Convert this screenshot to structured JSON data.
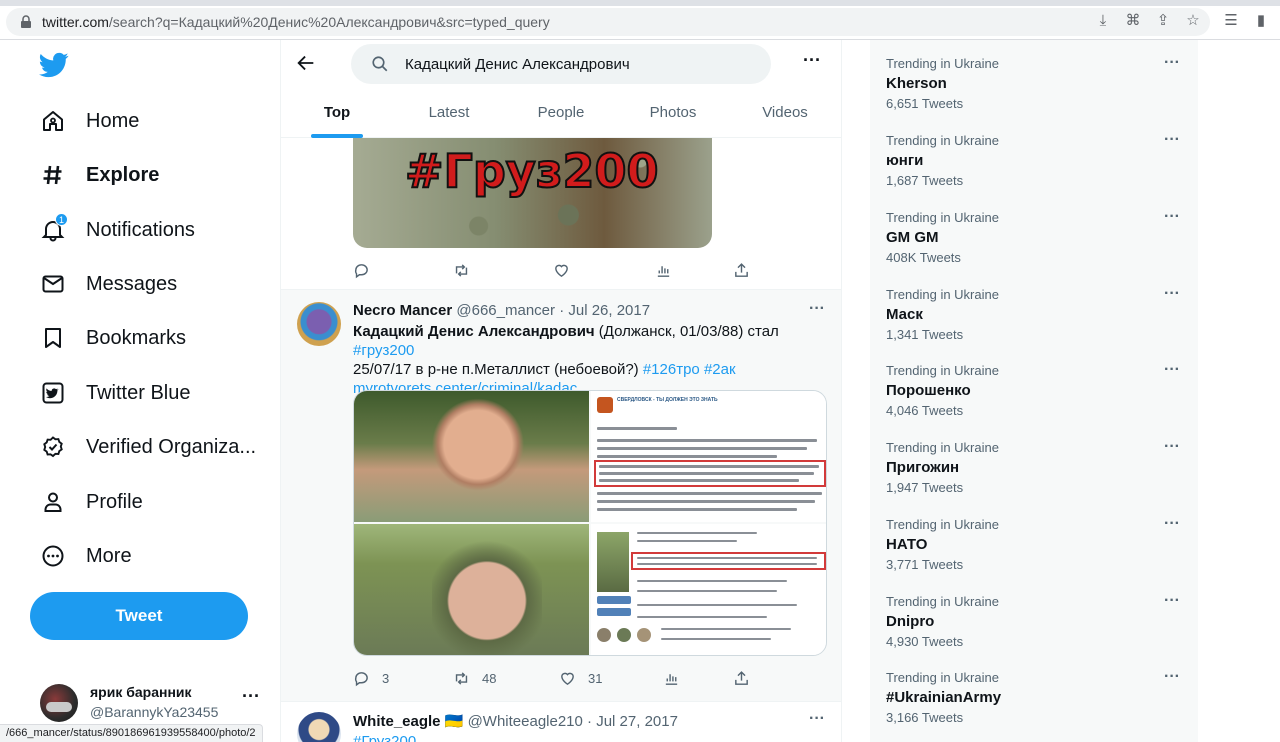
{
  "browser": {
    "url_host": "twitter.com",
    "url_rest": "/search?q=Кадацкий%20Денис%20Александрович&src=typed_query",
    "status_url": "/666_mancer/status/890186961939558400/photo/2"
  },
  "nav": {
    "items": [
      {
        "label": "Home",
        "icon": "home-icon"
      },
      {
        "label": "Explore",
        "icon": "hashtag-icon"
      },
      {
        "label": "Notifications",
        "icon": "bell-icon",
        "badge": "1"
      },
      {
        "label": "Messages",
        "icon": "envelope-icon"
      },
      {
        "label": "Bookmarks",
        "icon": "bookmark-icon"
      },
      {
        "label": "Twitter Blue",
        "icon": "twitter-blue-icon"
      },
      {
        "label": "Verified Organiza...",
        "icon": "verified-icon"
      },
      {
        "label": "Profile",
        "icon": "person-icon"
      },
      {
        "label": "More",
        "icon": "more-circle-icon"
      }
    ],
    "tweet_button": "Tweet",
    "account": {
      "name": "ярик баранник",
      "handle": "@BarannykYa23455"
    }
  },
  "search": {
    "query": "Кадацкий Денис Александрович",
    "tabs": [
      "Top",
      "Latest",
      "People",
      "Photos",
      "Videos"
    ],
    "active_tab": "Top"
  },
  "tweet0": {
    "image_text": "#Груз200"
  },
  "tweet1": {
    "name": "Necro Mancer",
    "handle": "@666_mancer",
    "date": "· Jul 26, 2017",
    "text_bold": "Кадацкий Денис Александрович",
    "text_1": " (Должанск, 01/03/88) стал ",
    "hashtag_1": "#груз200",
    "text_2": "25/07/17 в р-не п.Металлист (небоевой?) ",
    "hashtag_2": "#126тро",
    "hashtag_3": "#2ак",
    "link": "myrotvorets.center/criminal/kadac...",
    "replies": "3",
    "retweets": "48",
    "likes": "31",
    "doc_title": "СВЕРДЛОВСК - ТЫ ДОЛЖЕН ЭТО ЗНАТЬ"
  },
  "tweet2": {
    "name": "White_eagle",
    "flag": "🇺🇦",
    "handle": "@Whiteeagle210",
    "date": "· Jul 27, 2017",
    "text": "#Груз200"
  },
  "trends": [
    {
      "category": "Trending in Ukraine",
      "title": "Kherson",
      "count": "6,651 Tweets"
    },
    {
      "category": "Trending in Ukraine",
      "title": "юнги",
      "count": "1,687 Tweets"
    },
    {
      "category": "Trending in Ukraine",
      "title": "GM GM",
      "count": "408K Tweets"
    },
    {
      "category": "Trending in Ukraine",
      "title": "Маск",
      "count": "1,341 Tweets"
    },
    {
      "category": "Trending in Ukraine",
      "title": "Порошенко",
      "count": "4,046 Tweets"
    },
    {
      "category": "Trending in Ukraine",
      "title": "Пригожин",
      "count": "1,947 Tweets"
    },
    {
      "category": "Trending in Ukraine",
      "title": "НАТО",
      "count": "3,771 Tweets"
    },
    {
      "category": "Trending in Ukraine",
      "title": "Dnipro",
      "count": "4,930 Tweets"
    },
    {
      "category": "Trending in Ukraine",
      "title": "#UkrainianArmy",
      "count": "3,166 Tweets"
    }
  ],
  "colors": {
    "accent": "#1d9bf0",
    "text": "#0f1419",
    "secondary": "#536471"
  }
}
